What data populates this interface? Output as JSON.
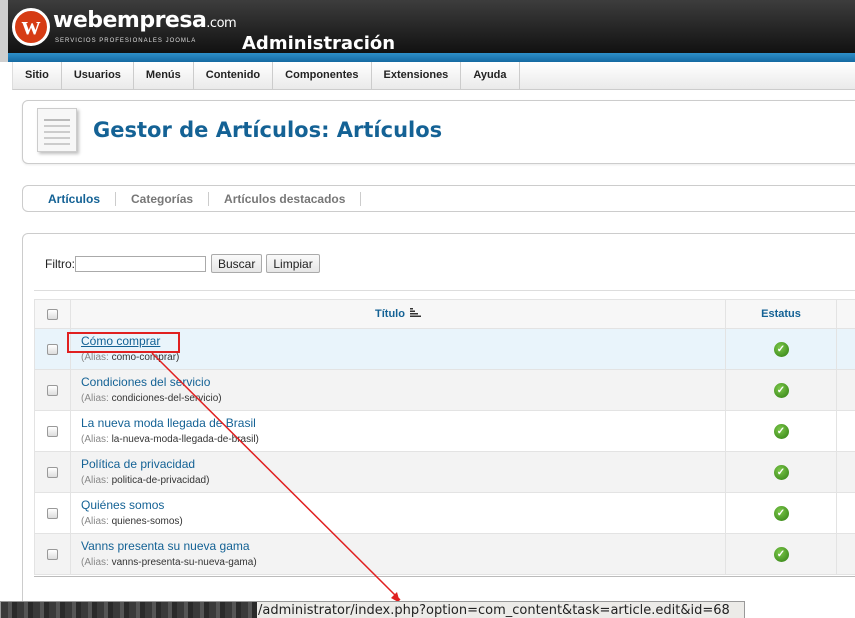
{
  "header": {
    "logo_mark": "w",
    "logo_name": "webempresa",
    "logo_suffix": ".com",
    "logo_tagline": "SERVICIOS PROFESIONALES JOOMLA",
    "admin_title": "Administración"
  },
  "menu": {
    "items": [
      {
        "label": "Sitio"
      },
      {
        "label": "Usuarios"
      },
      {
        "label": "Menús"
      },
      {
        "label": "Contenido"
      },
      {
        "label": "Componentes"
      },
      {
        "label": "Extensiones"
      },
      {
        "label": "Ayuda"
      }
    ]
  },
  "toolbar": {
    "page_title": "Gestor de Artículos: Artículos",
    "icon": "article-icon"
  },
  "submenu": {
    "items": [
      {
        "label": "Artículos",
        "active": true
      },
      {
        "label": "Categorías",
        "active": false
      },
      {
        "label": "Artículos destacados",
        "active": false
      }
    ]
  },
  "filter": {
    "label": "Filtro:",
    "value": "",
    "search_button": "Buscar",
    "clear_button": "Limpiar"
  },
  "table": {
    "columns": {
      "title": "Título",
      "status": "Estatus"
    },
    "sort_icon": "sort-icon",
    "status_icon": "published-check-icon",
    "alias_label": "(Alias:",
    "rows": [
      {
        "title": "Cómo comprar",
        "alias": "como-comprar)"
      },
      {
        "title": "Condiciones del servicio",
        "alias": "condiciones-del-servicio)"
      },
      {
        "title": "La nueva moda llegada de Brasil",
        "alias": "la-nueva-moda-llegada-de-brasil)"
      },
      {
        "title": "Política de privacidad",
        "alias": "politica-de-privacidad)"
      },
      {
        "title": "Quiénes somos",
        "alias": "quienes-somos)"
      },
      {
        "title": "Vanns presenta su nueva gama",
        "alias": "vanns-presenta-su-nueva-gama)"
      }
    ]
  },
  "annotation": {
    "color": "#e02020"
  },
  "status_bar": {
    "url_visible": "/administrator/index.php?option=com_content&task=article.edit&id=68"
  },
  "colors": {
    "accent": "#146295",
    "header_stripe": "#2d8fc9",
    "logo_red": "#d63c14",
    "status_green": "#3c9a1c"
  }
}
